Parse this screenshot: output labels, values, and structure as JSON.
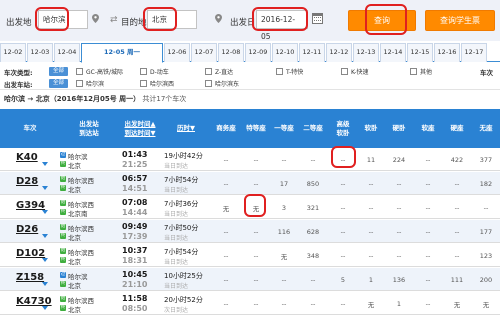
{
  "search": {
    "from_label": "出发地",
    "from_value": "哈尔滨",
    "to_label": "目的地",
    "to_value": "北京",
    "date_label": "出发日",
    "date_value": "2016-12-05",
    "query_button": "查询",
    "student_button": "查询学生票"
  },
  "date_tabs": [
    {
      "label": "12-02"
    },
    {
      "label": "12-03"
    },
    {
      "label": "12-04"
    },
    {
      "label": "12-05 周一"
    },
    {
      "label": "12-06"
    },
    {
      "label": "12-07"
    },
    {
      "label": "12-08"
    },
    {
      "label": "12-09"
    },
    {
      "label": "12-10"
    },
    {
      "label": "12-11"
    },
    {
      "label": "12-12"
    },
    {
      "label": "12-13"
    },
    {
      "label": "12-14"
    },
    {
      "label": "12-15"
    },
    {
      "label": "12-16"
    },
    {
      "label": "12-17"
    }
  ],
  "filters": {
    "type_label": "车次类型:",
    "station_label": "出发车站:",
    "right_label": "车次",
    "all": "全部",
    "types": [
      "GC-高铁/城际",
      "D-动车",
      "Z-直达",
      "T-特快",
      "K-快速",
      "其他"
    ],
    "stations": [
      "哈尔滨",
      "哈尔滨西",
      "哈尔滨东"
    ]
  },
  "route": {
    "text": "哈尔滨 → 北京（2016年12月05号 周一）",
    "count": "共计17个车次"
  },
  "table": {
    "headers": {
      "train": "车次",
      "station_a": "出发站",
      "station_b": "到达站",
      "time_a": "出发时间▲",
      "time_b": "到达时间▼",
      "duration": "历时▼",
      "business": "商务座",
      "special": "特等座",
      "first": "一等座",
      "second": "二等座",
      "premium_a": "高级",
      "premium_b": "软卧",
      "soft_sleeper": "软卧",
      "hard_sleeper": "硬卧",
      "soft_seat": "软座",
      "hard_seat": "硬座",
      "no_seat": "无座"
    },
    "rows": [
      {
        "train": "K40",
        "from_icon": "过",
        "from": "哈尔滨",
        "to_icon": "终",
        "to": "北京",
        "dep": "01:43",
        "arr": "21:25",
        "dur": "19小时42分",
        "day": "当日到达",
        "business": "--",
        "special": "--",
        "first": "--",
        "second": "--",
        "premium": "--",
        "soft_sleeper": "11",
        "hard_sleeper": "224",
        "soft_seat": "--",
        "hard_seat": "422",
        "no_seat": "377"
      },
      {
        "train": "D28",
        "from_icon": "始",
        "from": "哈尔滨西",
        "to_icon": "终",
        "to": "北京",
        "dep": "06:57",
        "arr": "14:51",
        "dur": "7小时54分",
        "day": "当日到达",
        "business": "--",
        "special": "--",
        "first": "17",
        "second": "850",
        "premium": "--",
        "soft_sleeper": "--",
        "hard_sleeper": "--",
        "soft_seat": "--",
        "hard_seat": "--",
        "no_seat": "182"
      },
      {
        "train": "G394",
        "from_icon": "始",
        "from": "哈尔滨西",
        "to_icon": "终",
        "to": "北京南",
        "dep": "07:08",
        "arr": "14:44",
        "dur": "7小时36分",
        "day": "当日到达",
        "business": "无",
        "special": "无",
        "first": "3",
        "second": "321",
        "premium": "--",
        "soft_sleeper": "--",
        "hard_sleeper": "--",
        "soft_seat": "--",
        "hard_seat": "--",
        "no_seat": "--"
      },
      {
        "train": "D26",
        "from_icon": "始",
        "from": "哈尔滨西",
        "to_icon": "终",
        "to": "北京",
        "dep": "09:49",
        "arr": "17:39",
        "dur": "7小时50分",
        "day": "当日到达",
        "business": "--",
        "special": "--",
        "first": "116",
        "second": "628",
        "premium": "--",
        "soft_sleeper": "--",
        "hard_sleeper": "--",
        "soft_seat": "--",
        "hard_seat": "--",
        "no_seat": "177"
      },
      {
        "train": "D102",
        "from_icon": "始",
        "from": "哈尔滨西",
        "to_icon": "终",
        "to": "北京",
        "dep": "10:37",
        "arr": "18:31",
        "dur": "7小时54分",
        "day": "当日到达",
        "business": "--",
        "special": "--",
        "first": "无",
        "second": "348",
        "premium": "--",
        "soft_sleeper": "--",
        "hard_sleeper": "--",
        "soft_seat": "--",
        "hard_seat": "--",
        "no_seat": "123"
      },
      {
        "train": "Z158",
        "from_icon": "过",
        "from": "哈尔滨",
        "to_icon": "终",
        "to": "北京",
        "dep": "10:45",
        "arr": "21:10",
        "dur": "10小时25分",
        "day": "当日到达",
        "business": "--",
        "special": "--",
        "first": "--",
        "second": "--",
        "premium": "5",
        "soft_sleeper": "1",
        "hard_sleeper": "136",
        "soft_seat": "--",
        "hard_seat": "111",
        "no_seat": "200"
      },
      {
        "train": "K4730",
        "from_icon": "始",
        "from": "哈尔滨西",
        "to_icon": "终",
        "to": "北京",
        "dep": "11:58",
        "arr": "08:50",
        "dur": "20小时52分",
        "day": "次日到达",
        "business": "--",
        "special": "--",
        "first": "--",
        "second": "--",
        "premium": "--",
        "soft_sleeper": "无",
        "hard_sleeper": "1",
        "soft_seat": "--",
        "hard_seat": "无",
        "no_seat": "无"
      }
    ]
  },
  "colors": {
    "accent": "#2a82d3",
    "button_orange": "#ff8a00",
    "highlight_red": "#e02020"
  }
}
